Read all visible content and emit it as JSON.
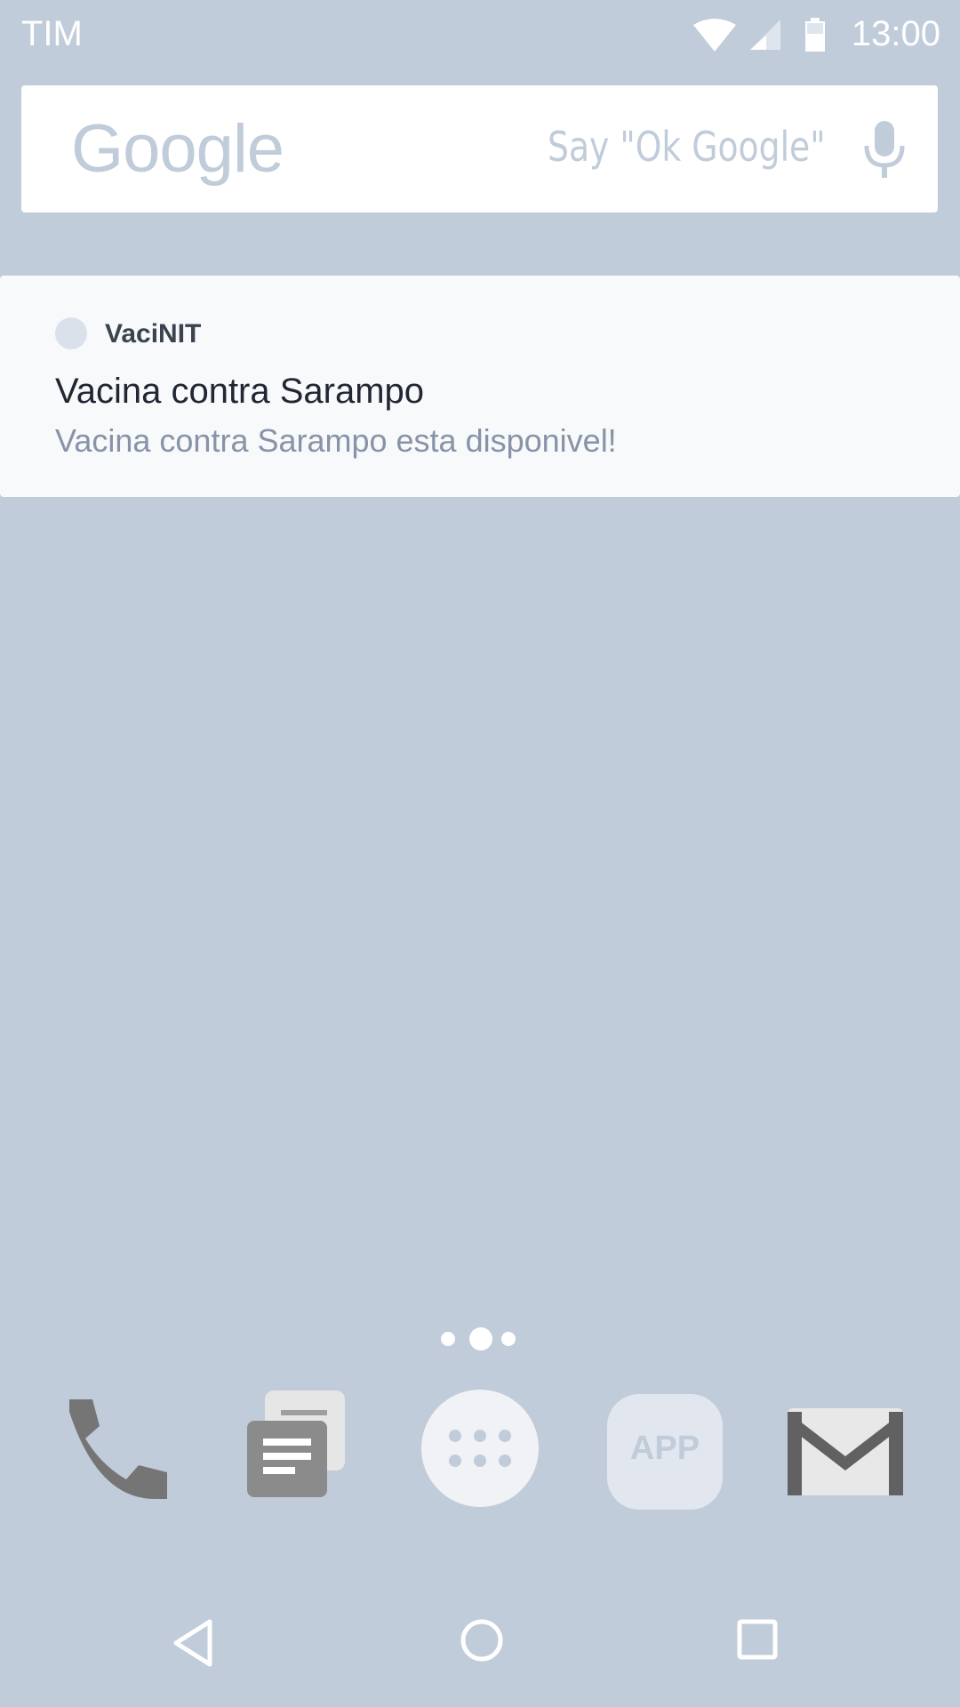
{
  "status_bar": {
    "carrier": "TIM",
    "time": "13:00",
    "icons": [
      "wifi-icon",
      "signal-icon",
      "battery-icon"
    ]
  },
  "search_widget": {
    "logo": "Google",
    "hint": "Say \"Ok Google\"",
    "icon": "mic-icon"
  },
  "notification": {
    "app_name": "VaciNIT",
    "title": "Vacina contra Sarampo",
    "body": "Vacina contra Sarampo esta disponivel!"
  },
  "page_indicator": {
    "pages": 3,
    "current": 2
  },
  "dock": {
    "apps": [
      "phone-icon",
      "messages-icon",
      "app-drawer-icon",
      "app-placeholder",
      "gmail-icon"
    ],
    "placeholder_label": "APP"
  },
  "nav_bar": [
    "back-icon",
    "home-icon",
    "recents-icon"
  ],
  "colors": {
    "wallpaper": "#c1ccda",
    "card": "#f7f9fb",
    "text_dark": "#212733",
    "text_muted": "#8793a6"
  }
}
